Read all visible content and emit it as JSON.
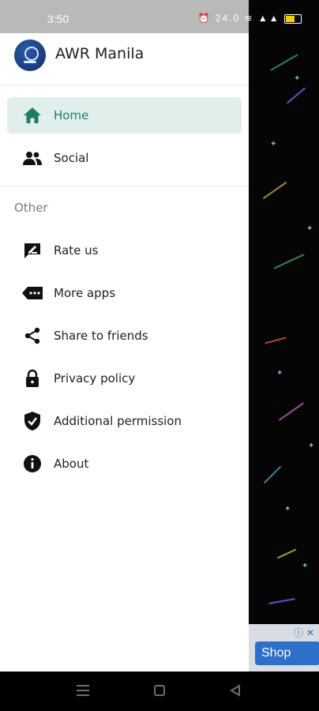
{
  "status_bar": {
    "time": "3:50",
    "icons_text": "⏰ 24.0 ≋ ▲▲ ",
    "battery_color": "#f1d000"
  },
  "drawer": {
    "app_title": "AWR Manila",
    "primary_items": [
      {
        "label": "Home",
        "icon": "home-icon",
        "active": true
      },
      {
        "label": "Social",
        "icon": "people-icon",
        "active": false
      }
    ],
    "section_title": "Other",
    "secondary_items": [
      {
        "label": "Rate us",
        "icon": "rate-icon"
      },
      {
        "label": "More apps",
        "icon": "more-apps-icon"
      },
      {
        "label": "Share to friends",
        "icon": "share-icon"
      },
      {
        "label": "Privacy policy",
        "icon": "lock-icon"
      },
      {
        "label": "Additional permission",
        "icon": "shield-check-icon"
      },
      {
        "label": "About",
        "icon": "info-icon"
      }
    ],
    "accent_color": "#1e7c6a",
    "active_bg": "#e1efec"
  },
  "ad": {
    "shop_label": "Shop",
    "icons_text": "ⓘ ✕"
  },
  "navbar": {
    "icons": [
      "menu-icon",
      "square-icon",
      "back-triangle-icon"
    ]
  }
}
